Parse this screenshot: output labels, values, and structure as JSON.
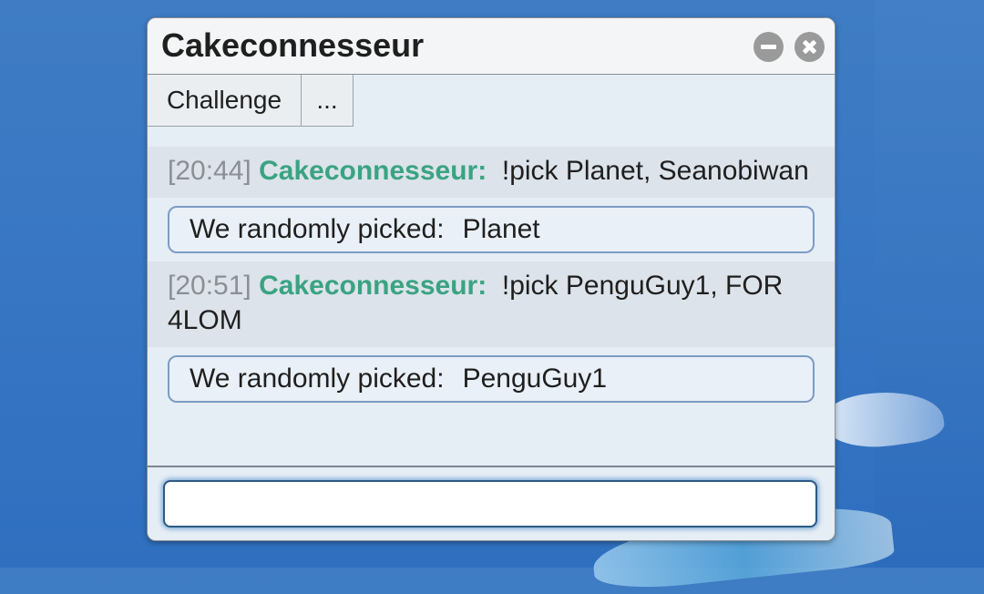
{
  "window": {
    "title": "Cakeconnesseur"
  },
  "toolbar": {
    "challenge_label": "Challenge",
    "more_label": "..."
  },
  "messages": [
    {
      "time": "[20:44]",
      "user": "Cakeconnesseur:",
      "text": "!pick Planet, Seanobiwan",
      "result_label": "We randomly picked:",
      "result_value": "Planet"
    },
    {
      "time": "[20:51]",
      "user": "Cakeconnesseur:",
      "text": "!pick PenguGuy1, FOR 4LOM",
      "result_label": "We randomly picked:",
      "result_value": "PenguGuy1"
    }
  ],
  "input": {
    "value": "",
    "placeholder": ""
  },
  "colors": {
    "username": "#3aa382",
    "timestamp": "#8a8f96",
    "pick_border": "#7d9cc3",
    "desktop": "#3a78c4"
  }
}
